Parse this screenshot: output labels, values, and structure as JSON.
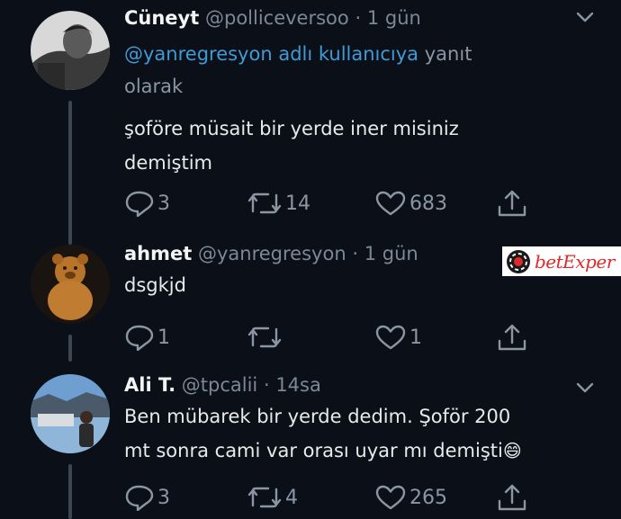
{
  "tweets": [
    {
      "name": "Cüneyt",
      "handle": "@polliceversoo",
      "time": "1 gün",
      "reply_to_mention": "@yanregresyon adlı kullanıcıya",
      "reply_to_suffix": "yanıt",
      "reply_to_line2": "olarak",
      "text_line1": "şoföre müsait bir yerde iner misiniz",
      "text_line2": "demiştim",
      "replies": "3",
      "retweets": "14",
      "likes": "683"
    },
    {
      "name": "ahmet",
      "handle": "@yanregresyon",
      "time": "1 gün",
      "text_line1": "dsgkjd",
      "replies": "1",
      "retweets": "",
      "likes": "1"
    },
    {
      "name": "Ali T.",
      "handle": "@tpcalii",
      "time": "14sa",
      "text_line1": "Ben mübarek bir yerde dedim. Şoför 200",
      "text_line2": "mt sonra cami var orası uyar mı demişti",
      "emoji": "😄",
      "replies": "3",
      "retweets": "4",
      "likes": "265"
    }
  ],
  "separator": "·",
  "watermark": {
    "brand": "betExper"
  }
}
